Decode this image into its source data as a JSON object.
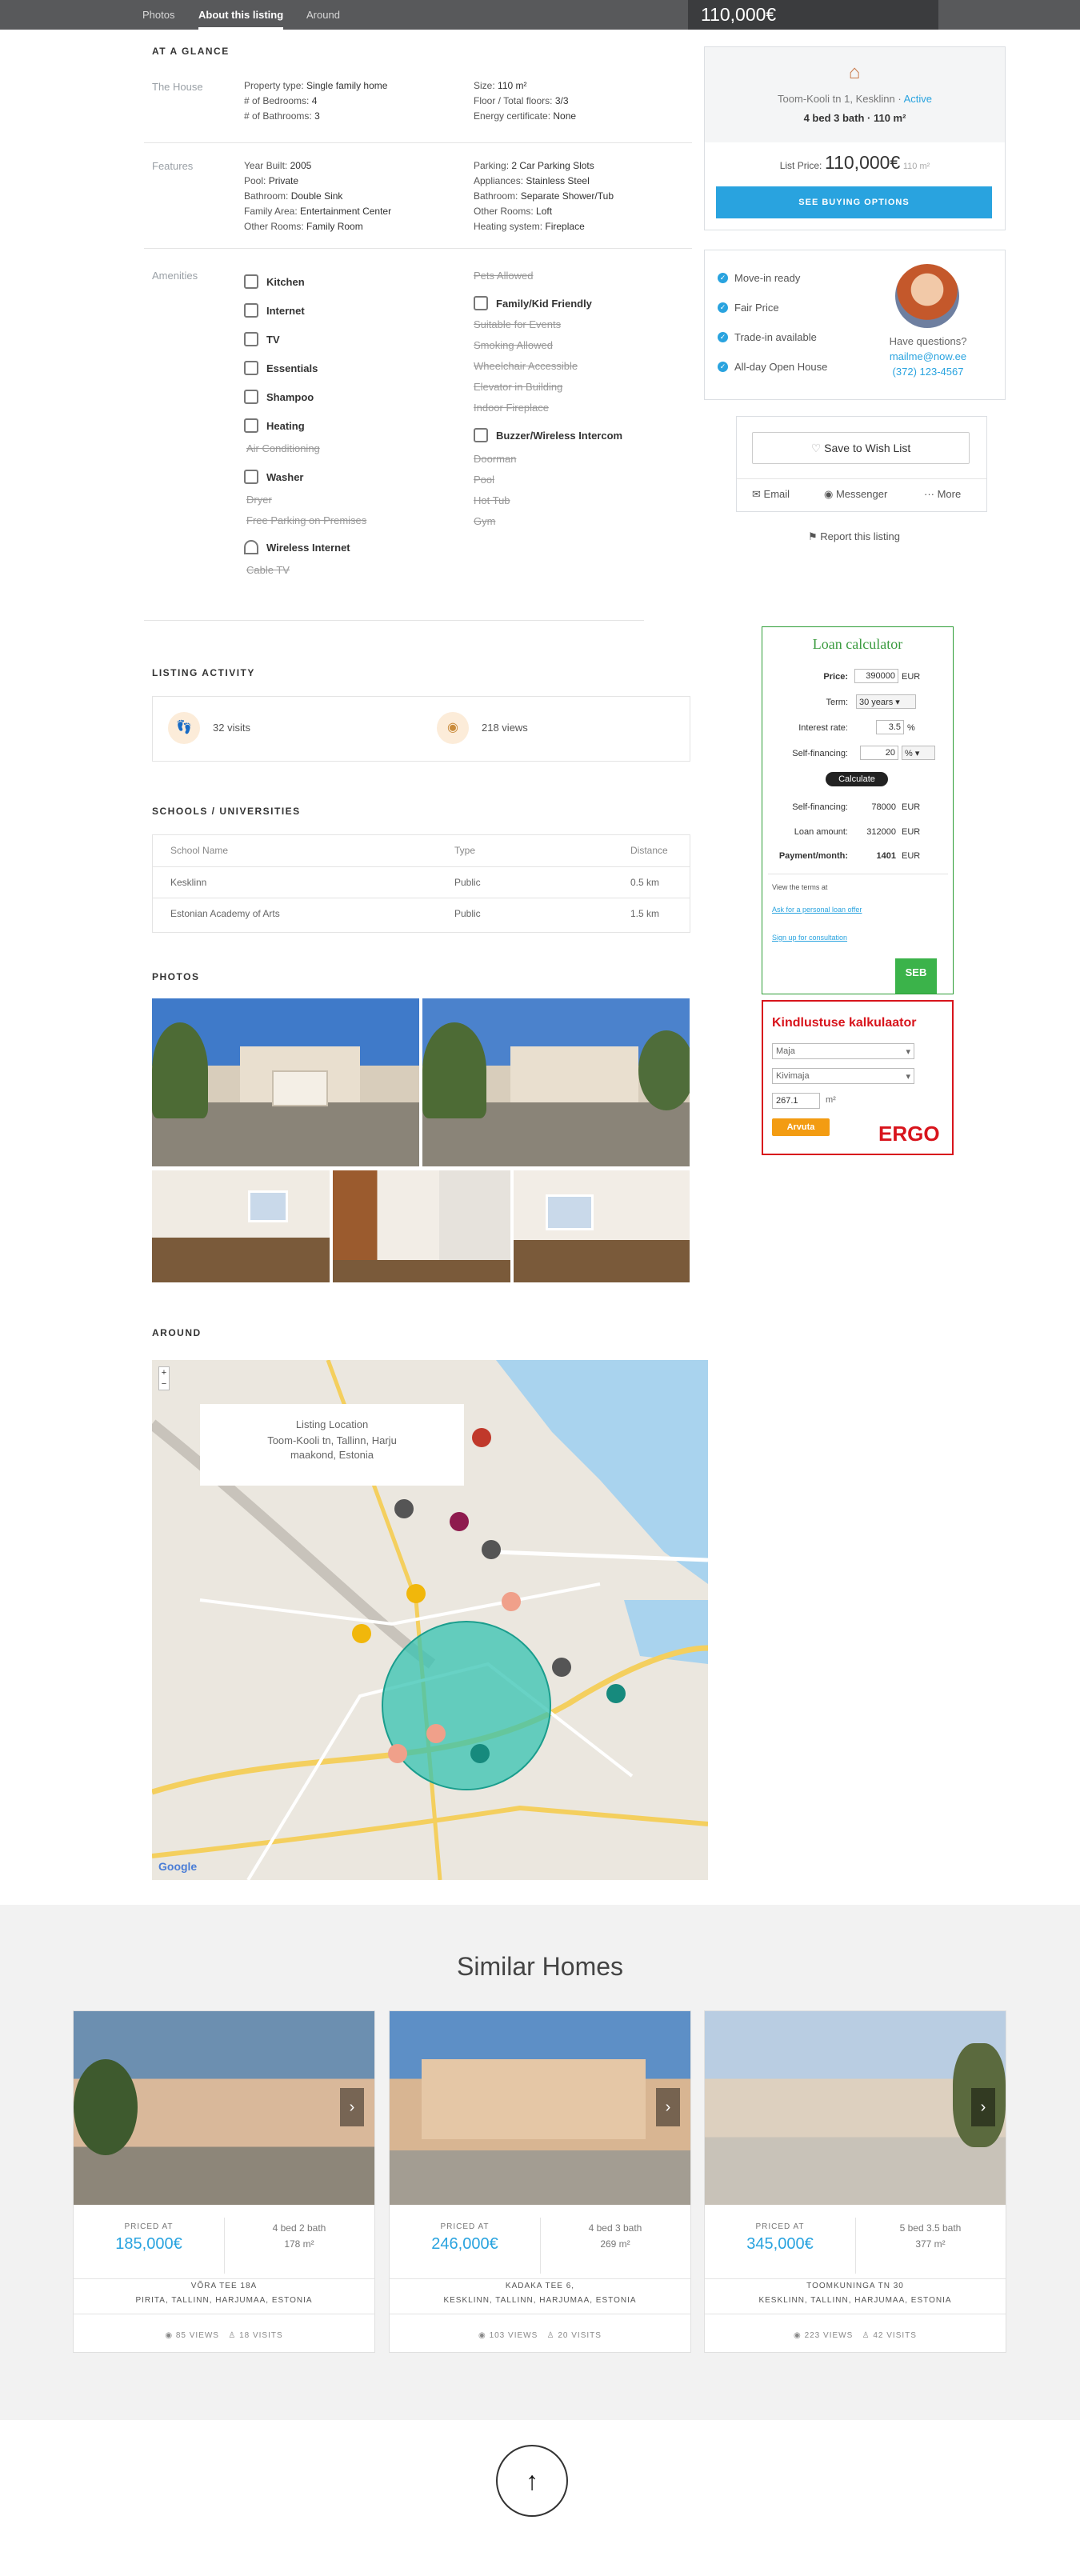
{
  "nav": {
    "tabs": [
      "Photos",
      "About this listing",
      "Around"
    ],
    "price": "110,000€"
  },
  "glance": {
    "title": "AT A GLANCE",
    "house_label": "The House",
    "house_left": [
      [
        "Property type:",
        "Single family home"
      ],
      [
        "# of Bedrooms:",
        "4"
      ],
      [
        "# of Bathrooms:",
        "3"
      ]
    ],
    "house_right": [
      [
        "Size:",
        "110 m²"
      ],
      [
        "Floor / Total floors:",
        "3/3"
      ],
      [
        "Energy certificate:",
        "None"
      ]
    ],
    "features_label": "Features",
    "features_left": [
      [
        "Year Built:",
        "2005"
      ],
      [
        "Pool:",
        "Private"
      ],
      [
        "Bathroom:",
        "Double Sink"
      ],
      [
        "Family Area:",
        "Entertainment Center"
      ],
      [
        "Other Rooms:",
        "Family Room"
      ]
    ],
    "features_right": [
      [
        "Parking:",
        "2 Car Parking Slots"
      ],
      [
        "Appliances:",
        "Stainless Steel"
      ],
      [
        "Bathroom:",
        "Separate Shower/Tub"
      ],
      [
        "Other Rooms:",
        "Loft"
      ],
      [
        "Heating system:",
        "Fireplace"
      ]
    ],
    "amenities_label": "Amenities"
  },
  "amenities_left": {
    "kitchen": "Kitchen",
    "internet": "Internet",
    "tv": "TV",
    "essentials": "Essentials",
    "shampoo": "Shampoo",
    "heating": "Heating",
    "air": "Air Conditioning",
    "washer": "Washer",
    "dryer": "Dryer",
    "free_parking": "Free Parking on Premises",
    "wireless": "Wireless Internet",
    "cable": "Cable TV"
  },
  "amenities_right": {
    "pets": "Pets Allowed",
    "family": "Family/Kid Friendly",
    "events": "Suitable for Events",
    "smoking": "Smoking Allowed",
    "wheelchair": "Wheelchair Accessible",
    "elevator": "Elevator in Building",
    "fireplace": "Indoor Fireplace",
    "buzzer": "Buzzer/Wireless Intercom",
    "doorman": "Doorman",
    "pool": "Pool",
    "hottub": "Hot Tub",
    "gym": "Gym"
  },
  "card": {
    "address": "Toom-Kooli tn 1, Kesklinn · ",
    "status": "Active",
    "summary": "4 bed 3 bath · 110 m²",
    "list_price_label": "List Price:",
    "list_price": "110,000€",
    "list_price_unit": "110 m²",
    "buy_button": "SEE BUYING OPTIONS"
  },
  "checks": {
    "move": "Move-in ready",
    "fair": "Fair Price",
    "trade": "Trade-in available",
    "open": "All-day Open House"
  },
  "agent": {
    "question": "Have questions?",
    "email": "mailme@now.ee",
    "phone": "(372) 123-4567"
  },
  "actions": {
    "wishlist": "Save to Wish List",
    "email": "Email",
    "messenger": "Messenger",
    "more": "··· More",
    "report": "Report this listing"
  },
  "activity": {
    "title": "LISTING ACTIVITY",
    "visits": "32 visits",
    "views": "218 views"
  },
  "schools": {
    "title": "SCHOOLS / UNIVERSITIES",
    "headers": [
      "School Name",
      "Type",
      "Distance"
    ],
    "rows": [
      [
        "Kesklinn",
        "Public",
        "0.5 km"
      ],
      [
        "Estonian Academy of Arts",
        "Public",
        "1.5 km"
      ]
    ]
  },
  "photos": {
    "title": "PHOTOS"
  },
  "around": {
    "title": "AROUND",
    "popup_title": "Listing Location",
    "popup_addr": "Toom-Kooli tn, Tallinn, Harju maakond, Estonia",
    "google": "Google",
    "zoom_in": "+",
    "zoom_out": "−"
  },
  "loan": {
    "title": "Loan calculator",
    "price_label": "Price:",
    "price": "390000",
    "eur": "EUR",
    "term_label": "Term:",
    "term": "30 years",
    "rate_label": "Interest rate:",
    "rate": "3.5",
    "pct": "%",
    "self_label": "Self-financing:",
    "self": "20",
    "calc": "Calculate",
    "self_fin_label": "Self-financing:",
    "self_fin": "78000",
    "loan_label": "Loan amount:",
    "loan_amt": "312000",
    "pay_label": "Payment/month:",
    "pay": "1401",
    "view_terms": "View the terms at",
    "ask": "Ask for a personal loan offer",
    "signup": "Sign up for consultation",
    "bank": "SEB"
  },
  "ergo": {
    "title": "Kindlustuse kalkulaator",
    "sel1": "Maja",
    "sel2": "Kivimaja",
    "area": "267.1",
    "unit": "m²",
    "btn": "Arvuta",
    "brand": "ERGO"
  },
  "similar": {
    "title": "Similar Homes",
    "priced": "PRICED AT",
    "homes": [
      {
        "price": "185,000€",
        "beds": "4 bed 2 bath",
        "size": "178 m²",
        "street": "VÕRA TEE 18A",
        "area": "PIRITA, TALLINN, HARJUMAA, ESTONIA",
        "views": "85 VIEWS",
        "visits": "18 VISITS"
      },
      {
        "price": "246,000€",
        "beds": "4 bed 3 bath",
        "size": "269 m²",
        "street": "KADAKA TEE 6,",
        "area": "KESKLINN, TALLINN, HARJUMAA, ESTONIA",
        "views": "103 VIEWS",
        "visits": "20 VISITS"
      },
      {
        "price": "345,000€",
        "beds": "5 bed 3.5 bath",
        "size": "377 m²",
        "street": "TOOMKUNINGA TN 30",
        "area": "KESKLINN, TALLINN, HARJUMAA, ESTONIA",
        "views": "223 VIEWS",
        "visits": "42 VISITS"
      }
    ]
  },
  "footer": {
    "up": "↑"
  }
}
